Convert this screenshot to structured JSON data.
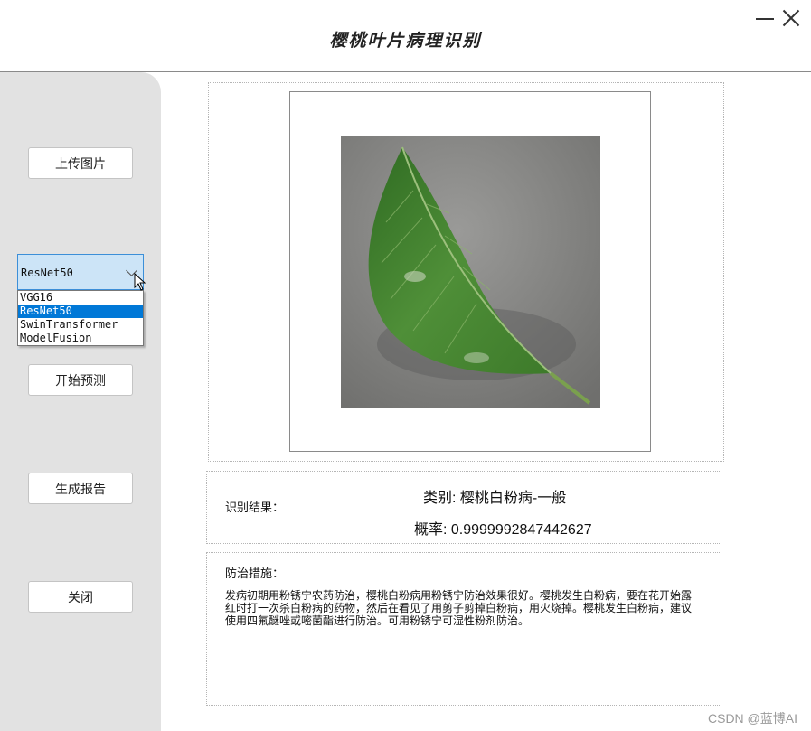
{
  "window": {
    "title": "樱桃叶片病理识别"
  },
  "sidebar": {
    "upload_label": "上传图片",
    "model_select": {
      "selected": "ResNet50",
      "options": [
        "VGG16",
        "ResNet50",
        "SwinTransformer",
        "ModelFusion"
      ],
      "highlighted_option": "ResNet50"
    },
    "predict_label": "开始预测",
    "report_label": "生成报告",
    "close_label": "关闭"
  },
  "result": {
    "label": "识别结果：",
    "class_text": "类别: 樱桃白粉病-一般",
    "prob_text": "概率: 0.9999992847442627"
  },
  "treatment": {
    "label": "防治措施：",
    "text": "发病初期用粉锈宁农药防治，樱桃白粉病用粉锈宁防治效果很好。樱桃发生白粉病，要在花开始露红时打一次杀白粉病的药物，然后在看见了用剪子剪掉白粉病，用火烧掉。樱桃发生白粉病，建议使用四氟醚唑或嘧菌酯进行防治。可用粉锈宁可湿性粉剂防治。"
  },
  "watermark": "CSDN @蓝博AI",
  "colors": {
    "selection": "#0078d7",
    "combo_bg": "#cce4f7",
    "sidebar_bg": "#e2e2e2"
  }
}
